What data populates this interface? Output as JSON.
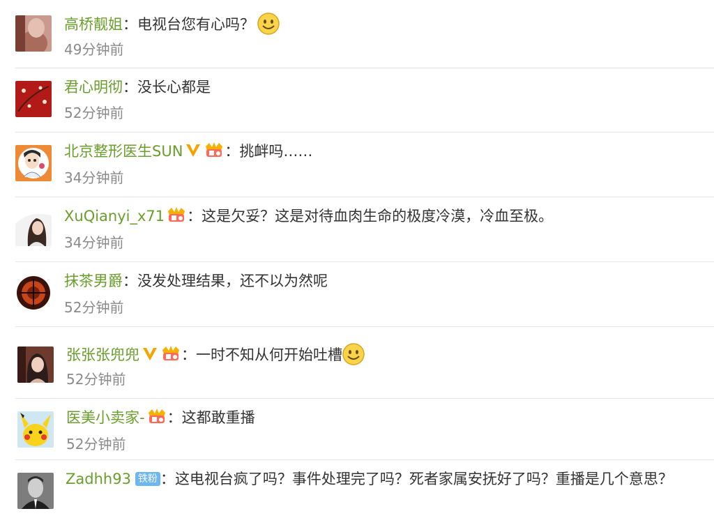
{
  "comments": [
    {
      "user": "高桥靓姐",
      "text": "电视台您有心吗？",
      "time": "49分钟前"
    },
    {
      "user": "君心明彻",
      "text": "没长心都是",
      "time": "52分钟前"
    },
    {
      "user": "北京整形医生SUN",
      "text": "挑衅吗……",
      "time": "34分钟前"
    },
    {
      "user": "XuQianyi_x71",
      "text": "这是欠妥？这是对待血肉生命的极度冷漠，冷血至极。",
      "time": "34分钟前"
    },
    {
      "user": "抹茶男爵",
      "text": "没发处理结果，还不以为然呢",
      "time": "52分钟前"
    },
    {
      "user": "张张张兜兜",
      "text": "一时不知从何开始吐槽",
      "time": "52分钟前"
    },
    {
      "user": "医美小卖家-",
      "text": "这都敢重播",
      "time": "52分钟前"
    },
    {
      "user": "Zadhh93",
      "fan_badge": "铁粉",
      "text": "这电视台疯了吗？事件处理完了吗？死者家属安抚好了吗？重播是几个意思？"
    }
  ],
  "colon": "："
}
